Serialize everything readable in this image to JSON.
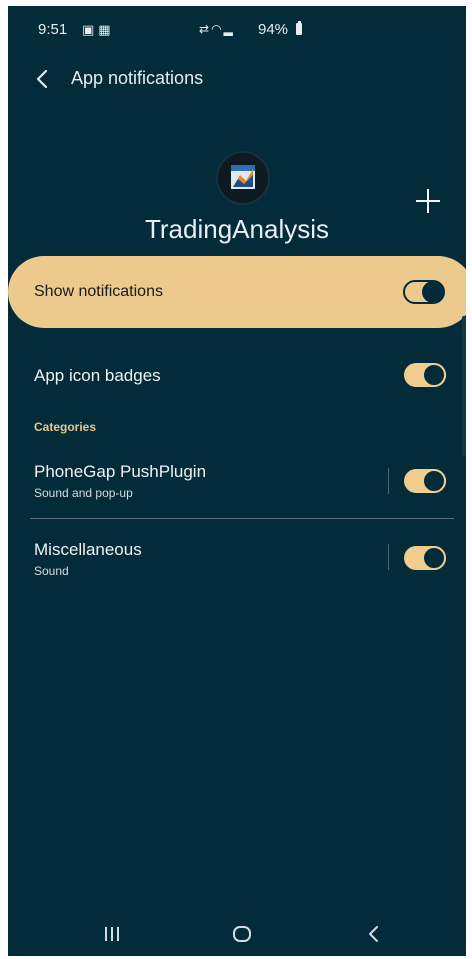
{
  "status_bar": {
    "time": "9:51",
    "battery": "94%",
    "left_icons": [
      "image-icon",
      "notification-icon"
    ],
    "right_icons": [
      "sync-icon",
      "wifi-icon",
      "signal-icon",
      "battery-icon"
    ]
  },
  "header": {
    "title": "App notifications",
    "back_icon": "chevron-left-icon"
  },
  "app": {
    "name": "TradingAnalysis",
    "icon": "app-icon",
    "add_icon": "plus-icon"
  },
  "show_notifications": {
    "label": "Show notifications",
    "enabled": true
  },
  "app_icon_badges": {
    "label": "App icon badges",
    "enabled": true
  },
  "categories": {
    "label": "Categories",
    "items": [
      {
        "title": "PhoneGap PushPlugin",
        "subtitle": "Sound and pop-up",
        "enabled": true
      },
      {
        "title": "Miscellaneous",
        "subtitle": "Sound",
        "enabled": true
      }
    ]
  },
  "nav_bar": {
    "icons": [
      "recent-apps-icon",
      "home-icon",
      "back-icon"
    ]
  },
  "colors": {
    "background": "#032b39",
    "accent": "#ecca8e",
    "text": "#ffffff"
  }
}
